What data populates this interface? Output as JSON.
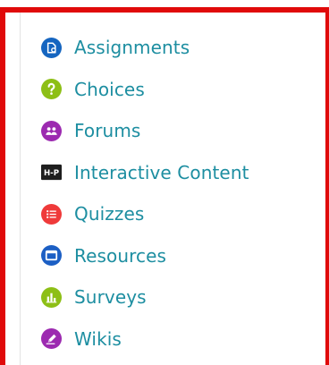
{
  "activities": {
    "items": [
      {
        "label": "Assignments",
        "icon": "assignment-icon",
        "color": "#1565c0"
      },
      {
        "label": "Choices",
        "icon": "question-icon",
        "color": "#8dbf16"
      },
      {
        "label": "Forums",
        "icon": "forum-icon",
        "color": "#9c2ab0"
      },
      {
        "label": "Interactive Content",
        "icon": "h5p-icon",
        "icon_text": "H-P",
        "color": "#1e1e1e"
      },
      {
        "label": "Quizzes",
        "icon": "quiz-icon",
        "color": "#ef3a3a"
      },
      {
        "label": "Resources",
        "icon": "resource-icon",
        "color": "#1c5fc4"
      },
      {
        "label": "Surveys",
        "icon": "survey-icon",
        "color": "#8dbf16"
      },
      {
        "label": "Wikis",
        "icon": "wiki-icon",
        "color": "#9c2ab0"
      }
    ],
    "link_color": "#1d8ea1",
    "frame_color": "#e00a0a"
  }
}
